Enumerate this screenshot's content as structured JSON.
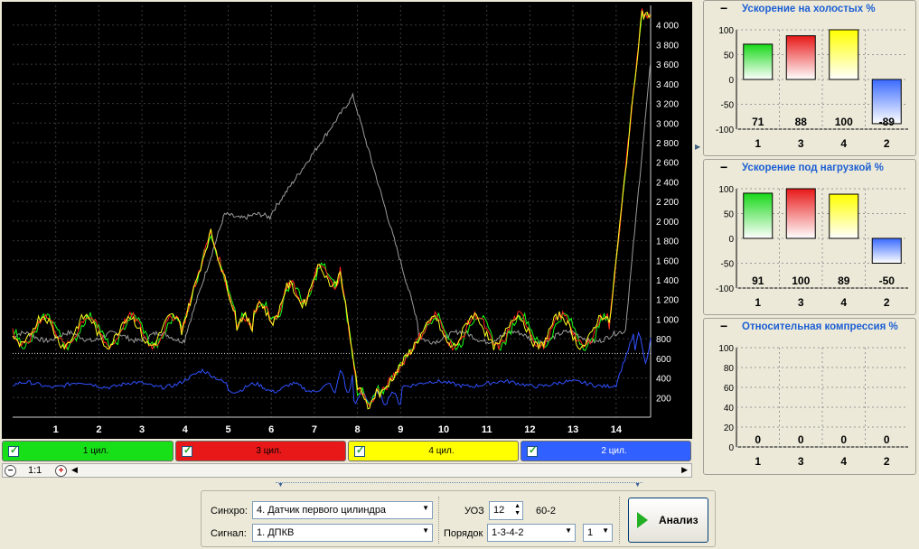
{
  "waveform": {
    "x_ticks": [
      "1",
      "2",
      "3",
      "4",
      "5",
      "6",
      "7",
      "8",
      "9",
      "10",
      "11",
      "12",
      "13",
      "14"
    ],
    "y_ticks": [
      "200",
      "400",
      "600",
      "800",
      "1 000",
      "1 200",
      "1 400",
      "1 600",
      "1 800",
      "2 000",
      "2 200",
      "2 400",
      "2 600",
      "2 800",
      "3 000",
      "3 200",
      "3 400",
      "3 600",
      "3 800",
      "4 000"
    ],
    "y_range": [
      0,
      4200
    ],
    "x_range": [
      0,
      14.8
    ],
    "threshold": 650,
    "colors": {
      "cyl1": "#18ff18",
      "cyl3": "#ff2020",
      "cyl4": "#ffff20",
      "cyl2": "#3050ff",
      "rpm": "#9a9a9a",
      "grid": "#3a3a3a",
      "axis_text": "#ffffff"
    }
  },
  "channels": [
    {
      "label": "1 цил.",
      "color": "#18e018"
    },
    {
      "label": "3 цил.",
      "color": "#e81818"
    },
    {
      "label": "4 цил.",
      "color": "#ffff00"
    },
    {
      "label": "2 цил.",
      "color": "#3060ff"
    }
  ],
  "zoom": {
    "ratio": "1:1"
  },
  "panels": [
    {
      "title": "Ускорение на холостых %",
      "minimize": "−",
      "y_ticks": [
        "100",
        "50",
        "0",
        "-50",
        "-100"
      ],
      "categories": [
        "1",
        "3",
        "4",
        "2"
      ],
      "values": [
        71,
        88,
        100,
        -89
      ]
    },
    {
      "title": "Ускорение под нагрузкой %",
      "minimize": "−",
      "y_ticks": [
        "100",
        "50",
        "0",
        "-50",
        "-100"
      ],
      "categories": [
        "1",
        "3",
        "4",
        "2"
      ],
      "values": [
        91,
        100,
        89,
        -50
      ]
    },
    {
      "title": "Относительная компрессия %",
      "minimize": "−",
      "y_ticks": [
        "100",
        "80",
        "60",
        "40",
        "20",
        "0"
      ],
      "categories": [
        "1",
        "3",
        "4",
        "2"
      ],
      "values": [
        0,
        0,
        0,
        0
      ]
    }
  ],
  "bar_colors": [
    "#18d818",
    "#e81818",
    "#ffff00",
    "#3a6aff"
  ],
  "controls": {
    "sync_label": "Синхро:",
    "sync_value": "4.  Датчик первого цилиндра",
    "signal_label": "Сигнал:",
    "signal_value": "1.  ДПКВ",
    "uoz_label": "УОЗ",
    "uoz_value": "12",
    "teeth": "60-2",
    "order_label": "Порядок",
    "order_value": "1-3-4-2",
    "order_num": "1",
    "analyze_label": "Анализ"
  }
}
